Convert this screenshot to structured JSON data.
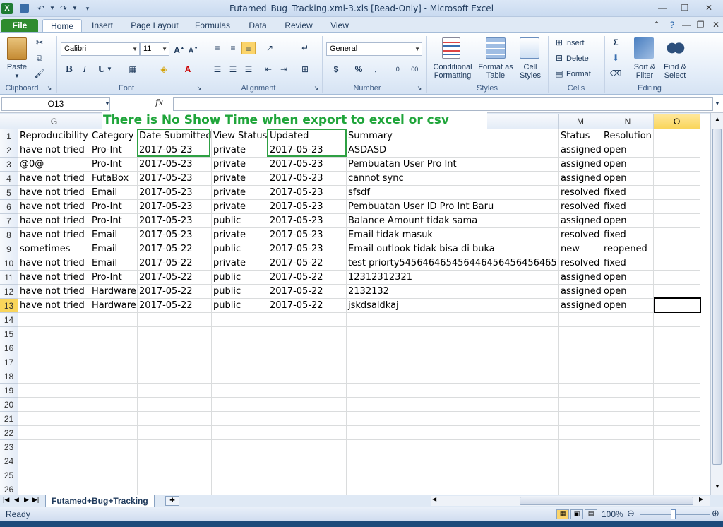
{
  "window": {
    "title": "Futamed_Bug_Tracking.xml-3.xls  [Read-Only]  -  Microsoft Excel"
  },
  "ribbon_tabs": [
    "File",
    "Home",
    "Insert",
    "Page Layout",
    "Formulas",
    "Data",
    "Review",
    "View"
  ],
  "ribbon": {
    "clipboard": {
      "paste": "Paste",
      "label": "Clipboard"
    },
    "font": {
      "name": "Calibri",
      "size": "11",
      "label": "Font",
      "bold": "B",
      "italic": "I",
      "underline": "U"
    },
    "alignment": {
      "label": "Alignment"
    },
    "number": {
      "format": "General",
      "label": "Number",
      "currency": "$",
      "percent": "%",
      "comma": ","
    },
    "styles": {
      "conditional": "Conditional Formatting",
      "format_table": "Format as Table",
      "cell_styles": "Cell Styles",
      "label": "Styles"
    },
    "cells": {
      "insert": "Insert",
      "delete": "Delete",
      "format": "Format",
      "label": "Cells"
    },
    "editing": {
      "sum": "Σ",
      "sort": "Sort & Filter",
      "find": "Find & Select",
      "label": "Editing"
    }
  },
  "formula_bar": {
    "name_box": "O13",
    "fx": "fx",
    "content": ""
  },
  "annotation": "There is No Show Time when export to excel or csv",
  "columns": [
    "G",
    "",
    "",
    "",
    "",
    "",
    "M",
    "N",
    "O"
  ],
  "rows": [
    [
      "Reproducibility",
      "Category",
      "Date Submitted",
      "View Status",
      "Updated",
      "Summary",
      "Status",
      "Resolution"
    ],
    [
      "have not tried",
      "Pro-Int",
      "2017-05-23",
      "private",
      "2017-05-23",
      "ASDASD",
      "assigned",
      "open"
    ],
    [
      "@0@",
      "Pro-Int",
      "2017-05-23",
      "private",
      "2017-05-23",
      "Pembuatan User Pro Int",
      "assigned",
      "open"
    ],
    [
      "have not tried",
      "FutaBox",
      "2017-05-23",
      "private",
      "2017-05-23",
      "cannot sync",
      "assigned",
      "open"
    ],
    [
      "have not tried",
      "Email",
      "2017-05-23",
      "private",
      "2017-05-23",
      "sfsdf",
      "resolved",
      "fixed"
    ],
    [
      "have not tried",
      "Pro-Int",
      "2017-05-23",
      "private",
      "2017-05-23",
      "Pembuatan User ID Pro Int Baru",
      "resolved",
      "fixed"
    ],
    [
      "have not tried",
      "Pro-Int",
      "2017-05-23",
      "public",
      "2017-05-23",
      "Balance Amount tidak sama",
      "assigned",
      "open"
    ],
    [
      "have not tried",
      "Email",
      "2017-05-23",
      "private",
      "2017-05-23",
      "Email tidak masuk",
      "resolved",
      "fixed"
    ],
    [
      "sometimes",
      "Email",
      "2017-05-22",
      "public",
      "2017-05-23",
      "Email outlook tidak bisa di buka",
      "new",
      "reopened"
    ],
    [
      "have not tried",
      "Email",
      "2017-05-22",
      "private",
      "2017-05-22",
      "test priorty545646465456446456456456465",
      "resolved",
      "fixed"
    ],
    [
      "have not tried",
      "Pro-Int",
      "2017-05-22",
      "public",
      "2017-05-22",
      "12312312321",
      "assigned",
      "open"
    ],
    [
      "have not tried",
      "Hardware",
      "2017-05-22",
      "public",
      "2017-05-22",
      "2132132",
      "assigned",
      "open"
    ],
    [
      "have not tried",
      "Hardware",
      "2017-05-22",
      "public",
      "2017-05-22",
      "jskdsaldkaj",
      "assigned",
      "open"
    ]
  ],
  "row_numbers": [
    "1",
    "2",
    "3",
    "4",
    "5",
    "6",
    "7",
    "8",
    "9",
    "10",
    "11",
    "12",
    "13",
    "14",
    "15",
    "16",
    "17",
    "18",
    "19",
    "20",
    "21",
    "22",
    "23",
    "24",
    "25",
    "26"
  ],
  "sheet_tab": "Futamed+Bug+Tracking",
  "status": {
    "ready": "Ready",
    "zoom": "100%"
  }
}
